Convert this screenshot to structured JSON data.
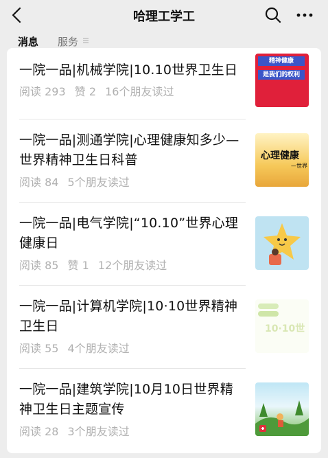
{
  "header": {
    "title": "哈理工学工",
    "back_icon": "back-arrow-icon",
    "search_icon": "search-icon",
    "more_icon": "more-dots-icon"
  },
  "tabs": [
    {
      "label": "消息",
      "active": true
    },
    {
      "label": "服务",
      "active": false
    }
  ],
  "articles": [
    {
      "title": "一院一品|机械学院|10.10世界卫生日",
      "reads": "阅读 293",
      "likes": "赞 2",
      "friends": "16个朋友读过",
      "thumb": {
        "text1": "精神健康",
        "text2": "是我们的权利"
      }
    },
    {
      "title": "一院一品|测通学院|心理健康知多少—世界精神卫生日科普",
      "reads": "阅读 84",
      "likes": "",
      "friends": "5个朋友读过",
      "thumb": {
        "text1": "心理健康",
        "text2": "—世界"
      }
    },
    {
      "title": "一院一品|电气学院|“10.10”世界心理健康日",
      "reads": "阅读 85",
      "likes": "赞 1",
      "friends": "12个朋友读过",
      "thumb": {}
    },
    {
      "title": "一院一品|计算机学院|10·10世界精神卫生日",
      "reads": "阅读 55",
      "likes": "",
      "friends": "4个朋友读过",
      "thumb": {
        "text1": "10·10世"
      }
    },
    {
      "title": "一院一品|建筑学院|10月10日世界精神卫生日主题宣传",
      "reads": "阅读 28",
      "likes": "",
      "friends": "3个朋友读过",
      "thumb": {}
    }
  ]
}
